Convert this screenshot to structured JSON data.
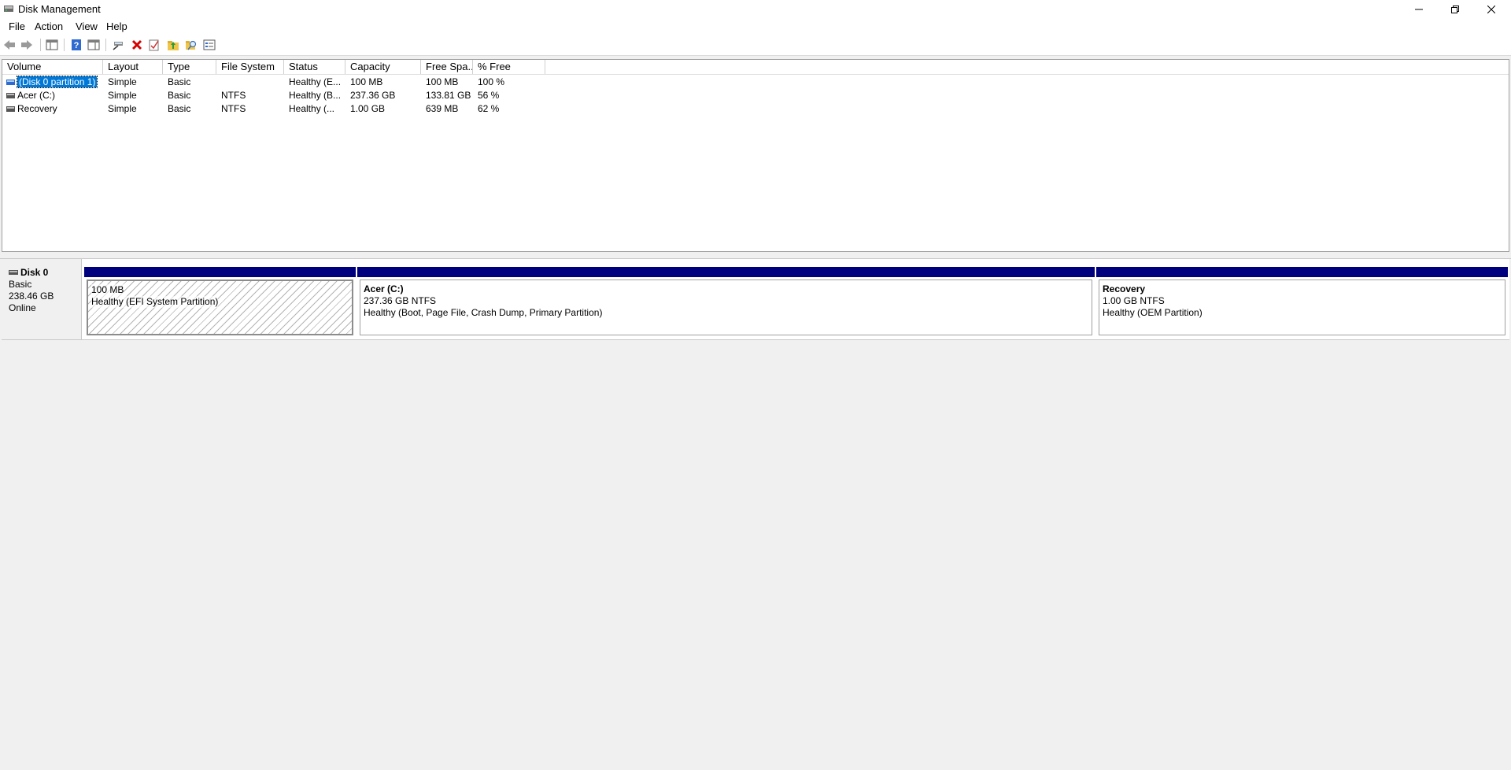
{
  "window": {
    "title": "Disk Management"
  },
  "menu": [
    "File",
    "Action",
    "View",
    "Help"
  ],
  "toolbar": {
    "icons": [
      "back-icon",
      "forward-icon",
      "show-hide-console-tree-icon",
      "help-icon",
      "properties-icon",
      "connect-icon",
      "delete-icon",
      "check-icon",
      "open-folder-icon",
      "search-folder-icon",
      "properties-list-icon"
    ]
  },
  "volumes": {
    "columns": [
      "Volume",
      "Layout",
      "Type",
      "File System",
      "Status",
      "Capacity",
      "Free Spa...",
      "% Free"
    ],
    "rows": [
      [
        "(Disk 0 partition 1)",
        "Simple",
        "Basic",
        "",
        "Healthy (E...",
        "100 MB",
        "100 MB",
        "100 %"
      ],
      [
        "Acer (C:)",
        "Simple",
        "Basic",
        "NTFS",
        "Healthy (B...",
        "237.36 GB",
        "133.81 GB",
        "56 %"
      ],
      [
        "Recovery",
        "Simple",
        "Basic",
        "NTFS",
        "Healthy (...",
        "1.00 GB",
        "639 MB",
        "62 %"
      ]
    ]
  },
  "disk": {
    "name": "Disk 0",
    "type": "Basic",
    "size": "238.46 GB",
    "status": "Online",
    "partitions": [
      {
        "name": "",
        "size": "100 MB",
        "status": "Healthy (EFI System Partition)"
      },
      {
        "name": "Acer  (C:)",
        "size": "237.36 GB NTFS",
        "status": "Healthy (Boot, Page File, Crash Dump, Primary Partition)"
      },
      {
        "name": "Recovery",
        "size": "1.00 GB NTFS",
        "status": "Healthy (OEM Partition)"
      }
    ]
  },
  "colors": {
    "partition_bar": "#00007f",
    "selection": "#0078d7"
  }
}
